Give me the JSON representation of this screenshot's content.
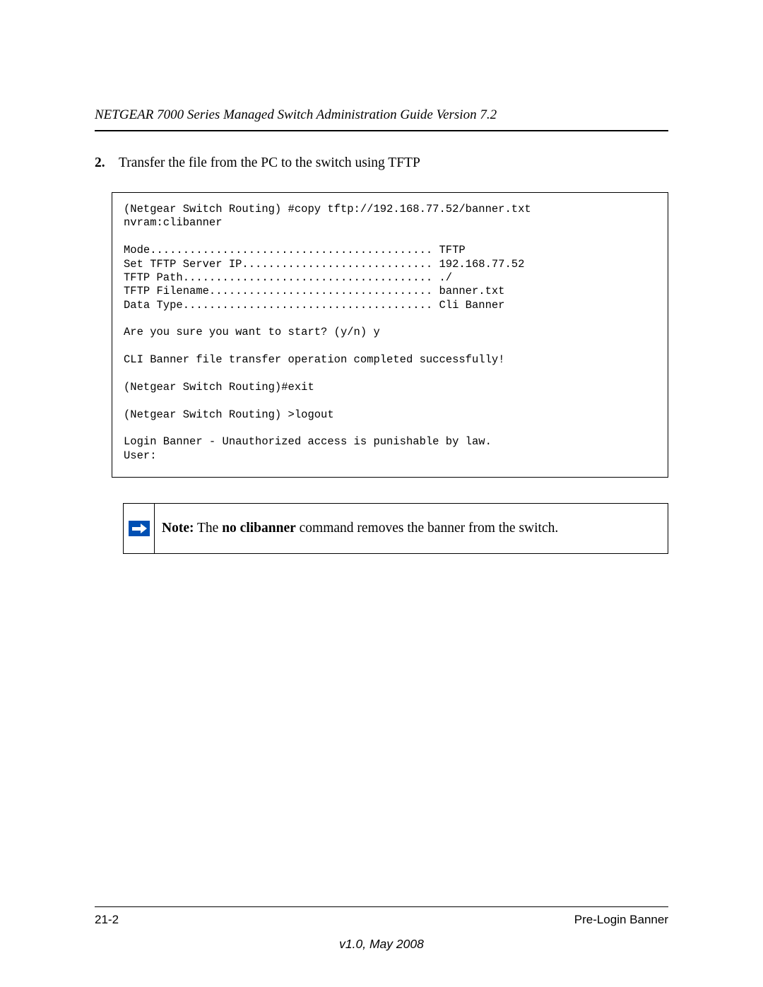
{
  "header": "NETGEAR 7000 Series Managed Switch Administration Guide Version 7.2",
  "step": {
    "number": "2.",
    "text": "Transfer the file from the PC to the switch using TFTP"
  },
  "code": "(Netgear Switch Routing) #copy tftp://192.168.77.52/banner.txt\nnvram:clibanner\n\nMode........................................... TFTP\nSet TFTP Server IP............................. 192.168.77.52\nTFTP Path...................................... ./\nTFTP Filename.................................. banner.txt\nData Type...................................... Cli Banner\n\nAre you sure you want to start? (y/n) y\n\nCLI Banner file transfer operation completed successfully!\n\n(Netgear Switch Routing)#exit\n\n(Netgear Switch Routing) >logout\n\nLogin Banner - Unauthorized access is punishable by law.\nUser:",
  "note": {
    "label": "Note:",
    "pre": " The ",
    "bold": "no clibanner",
    "post": " command removes the banner from the switch."
  },
  "footer": {
    "page_num": "21-2",
    "section": "Pre-Login Banner",
    "version": "v1.0, May 2008"
  }
}
